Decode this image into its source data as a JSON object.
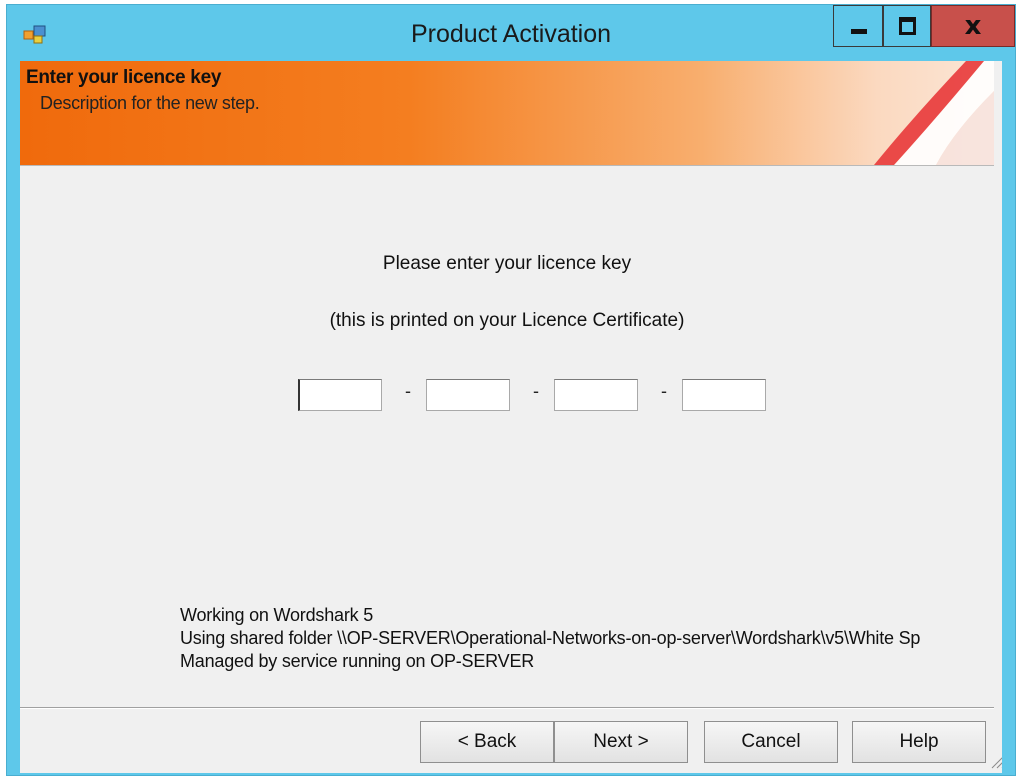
{
  "window": {
    "title": "Product Activation",
    "controls": {
      "minimize_icon": "minimize-icon",
      "maximize_icon": "maximize-icon",
      "close_glyph": "x"
    }
  },
  "header": {
    "title": "Enter your licence key",
    "description": "Description for the new step."
  },
  "main": {
    "prompt_line1": "Please enter your licence key",
    "prompt_line2": "(this is printed on your Licence Certificate)",
    "key_fields": [
      "",
      "",
      "",
      ""
    ],
    "separator": "-"
  },
  "status": {
    "line1": "Working on Wordshark 5",
    "line2": "Using shared folder \\\\OP-SERVER\\Operational-Networks-on-op-server\\Wordshark\\v5\\White Sp",
    "line3": "Managed by service running on OP-SERVER"
  },
  "buttons": {
    "back": "< Back",
    "next": "Next >",
    "cancel": "Cancel",
    "help": "Help"
  },
  "colors": {
    "titlebar": "#5ec8ea",
    "banner_start": "#f06a0c",
    "banner_end": "#fbe6d6",
    "close_button": "#c8504b",
    "client_bg": "#f0f0f0"
  }
}
